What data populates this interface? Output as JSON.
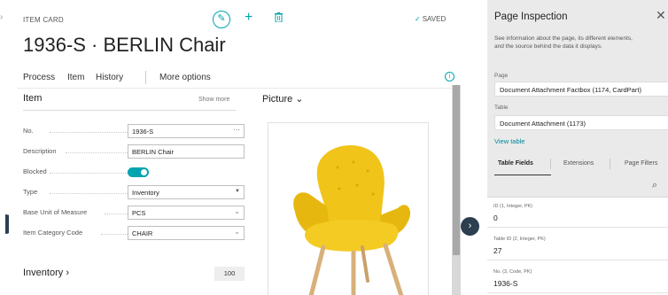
{
  "card": {
    "type_label": "ITEM CARD",
    "saved_label": "SAVED",
    "title": "1936-S · BERLIN Chair",
    "actions": [
      "Process",
      "Item",
      "History",
      "More options"
    ]
  },
  "item_section": {
    "title": "Item",
    "show_more": "Show more",
    "fields": {
      "no": {
        "label": "No.",
        "value": "1936-S"
      },
      "description": {
        "label": "Description",
        "value": "BERLIN Chair"
      },
      "blocked": {
        "label": "Blocked",
        "value": true
      },
      "type": {
        "label": "Type",
        "value": "Inventory"
      },
      "base_unit": {
        "label": "Base Unit of Measure",
        "value": "PCS"
      },
      "category": {
        "label": "Item Category Code",
        "value": "CHAIR"
      }
    }
  },
  "inventory_section": {
    "title": "Inventory",
    "value": "100"
  },
  "picture_section": {
    "title": "Picture"
  },
  "inspector": {
    "title": "Page Inspection",
    "description_line1": "See information about the page, its different elements,",
    "description_line2": "and the source behind the data it displays.",
    "page_label": "Page",
    "page_value": "Document Attachment Factbox (1174, CardPart)",
    "table_label": "Table",
    "table_value": "Document Attachment (1173)",
    "view_table": "View table",
    "tabs": [
      "Table Fields",
      "Extensions",
      "Page Filters"
    ],
    "fields": [
      {
        "label": "ID (1, Integer, PK)",
        "value": "0"
      },
      {
        "label": "Table ID (2, Integer, PK)",
        "value": "27"
      },
      {
        "label": "No. (3, Code, PK)",
        "value": "1936-S"
      }
    ]
  },
  "colors": {
    "accent": "#00a4b0",
    "chair": "#f0c419",
    "nav": "#2c3e50"
  },
  "icons": [
    "edit-icon",
    "plus-icon",
    "delete-icon",
    "checkmark-icon",
    "info-icon",
    "close-icon",
    "search-icon",
    "chevron-right-icon",
    "chevron-down-icon"
  ]
}
